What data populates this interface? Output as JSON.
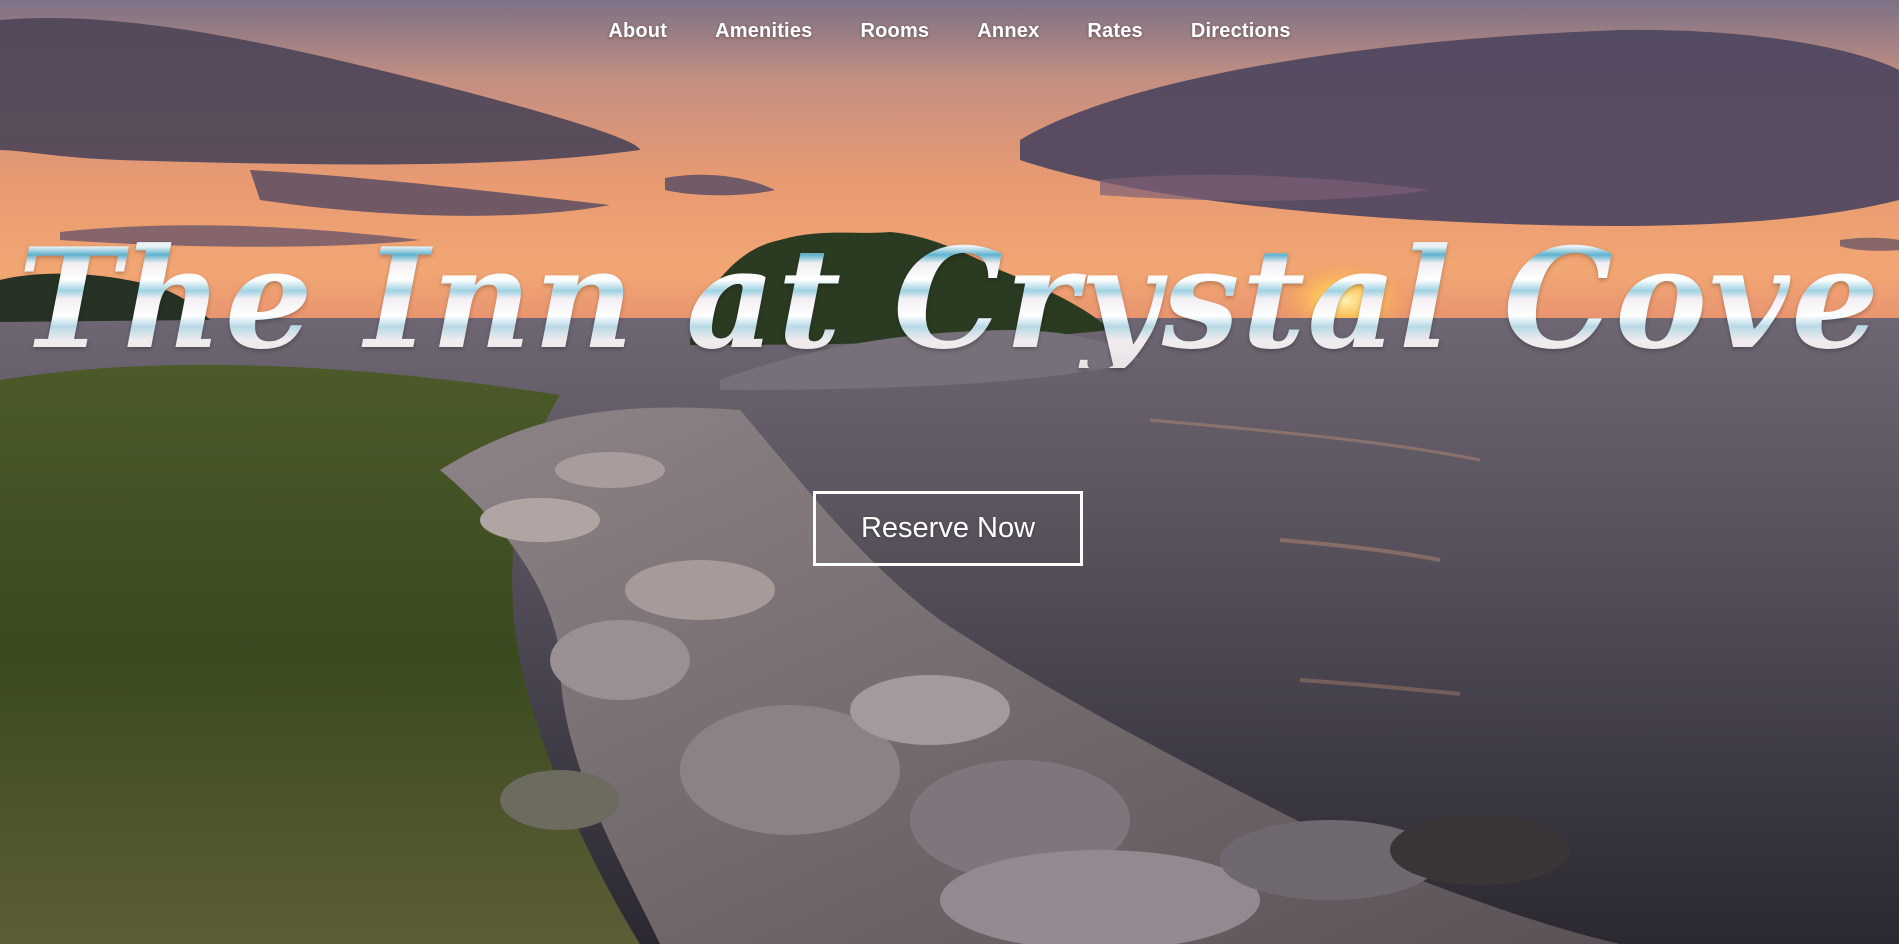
{
  "nav": {
    "items": [
      {
        "label": "About"
      },
      {
        "label": "Amenities"
      },
      {
        "label": "Rooms"
      },
      {
        "label": "Annex"
      },
      {
        "label": "Rates"
      },
      {
        "label": "Directions"
      }
    ]
  },
  "hero": {
    "title": "The Inn at Crystal Cove",
    "cta_label": "Reserve Now"
  },
  "colors": {
    "nav_text": "#ffffff",
    "button_border": "#ffffff",
    "title_tint": "#5fb2cf"
  }
}
